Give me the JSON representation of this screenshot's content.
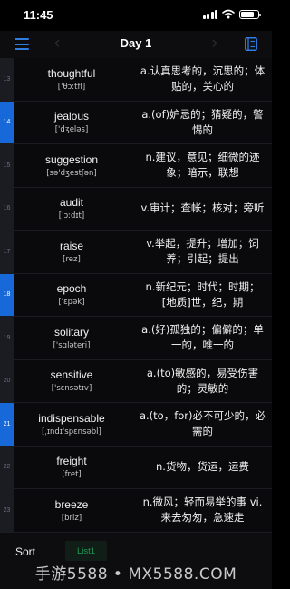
{
  "status": {
    "time": "11:45"
  },
  "nav": {
    "title": "Day 1",
    "menu_icon": "hamburger-menu-icon",
    "book_icon": "book-icon"
  },
  "words": [
    {
      "num": "13",
      "active": false,
      "word": "thoughtful",
      "phonetic": "['θɔːtfl]",
      "meaning": "a.认真思考的，沉思的；体贴的，关心的"
    },
    {
      "num": "14",
      "active": true,
      "word": "jealous",
      "phonetic": "['dʒeləs]",
      "meaning": "a.(of)妒忌的；猜疑的，警惕的"
    },
    {
      "num": "15",
      "active": false,
      "word": "suggestion",
      "phonetic": "[sə'dʒestʃən]",
      "meaning": "n.建议，意见；细微的迹象；暗示，联想"
    },
    {
      "num": "16",
      "active": false,
      "word": "audit",
      "phonetic": "['ɔːdɪt]",
      "meaning": "v.审计；查帐；核对；旁听"
    },
    {
      "num": "17",
      "active": false,
      "word": "raise",
      "phonetic": "[rez]",
      "meaning": "v.举起，提升；增加；饲养；引起；提出"
    },
    {
      "num": "18",
      "active": true,
      "word": "epoch",
      "phonetic": "['ɛpək]",
      "meaning": "n.新纪元；时代；时期；[地质]世，纪，期"
    },
    {
      "num": "19",
      "active": false,
      "word": "solitary",
      "phonetic": "['sɑləteri]",
      "meaning": "a.(好)孤独的；偏僻的；单一的，唯一的"
    },
    {
      "num": "20",
      "active": false,
      "word": "sensitive",
      "phonetic": "['sɛnsətɪv]",
      "meaning": "a.(to)敏感的，易受伤害的；灵敏的"
    },
    {
      "num": "21",
      "active": true,
      "word": "indispensable",
      "phonetic": "[ˌɪndɪ'spɛnsəbl]",
      "meaning": "a.(to，for)必不可少的，必需的"
    },
    {
      "num": "22",
      "active": false,
      "word": "freight",
      "phonetic": "[fret]",
      "meaning": "n.货物，货运，运费"
    },
    {
      "num": "23",
      "active": false,
      "word": "breeze",
      "phonetic": "[briz]",
      "meaning": "n.微风；轻而易举的事 vi.来去匆匆，急速走"
    }
  ],
  "bottom": {
    "sort_label": "Sort",
    "list_label": "List1"
  },
  "watermark": "手游5588 • MX5588.COM",
  "colors": {
    "accent": "#2f7de1",
    "active_row": "#1768d8",
    "list_tab": "#1f9a55"
  }
}
